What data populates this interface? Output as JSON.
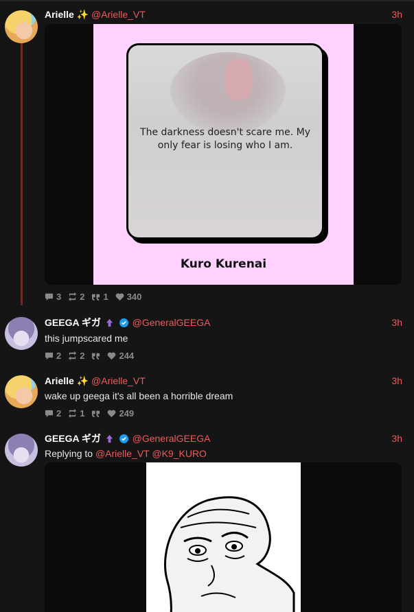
{
  "colors": {
    "accent": "#f05a5a",
    "background": "#151515",
    "thread": "#6b2a2a",
    "card_bg": "#ffd1ff"
  },
  "tweets": [
    {
      "name": "Arielle",
      "emoji": "✨",
      "handle": "@Arielle_VT",
      "time": "3h",
      "card": {
        "quote": "The darkness doesn't scare me. My only fear is losing who I am.",
        "name": "Kuro Kurenai"
      },
      "stats": {
        "replies": "3",
        "retweets": "2",
        "quotes": "1",
        "likes": "340"
      }
    },
    {
      "name": "GEEGA ギガ",
      "handle": "@GeneralGEEGA",
      "time": "3h",
      "text": "this jumpscared me",
      "stats": {
        "replies": "2",
        "retweets": "2",
        "quotes": "",
        "likes": "244"
      }
    },
    {
      "name": "Arielle",
      "emoji": "✨",
      "handle": "@Arielle_VT",
      "time": "3h",
      "text": "wake up geega it's all been a horrible dream",
      "stats": {
        "replies": "2",
        "retweets": "1",
        "quotes": "",
        "likes": "249"
      }
    },
    {
      "name": "GEEGA ギガ",
      "handle": "@GeneralGEEGA",
      "time": "3h",
      "replying_prefix": "Replying to",
      "replying_to": [
        "@Arielle_VT",
        "@K9_KURO"
      ]
    }
  ]
}
